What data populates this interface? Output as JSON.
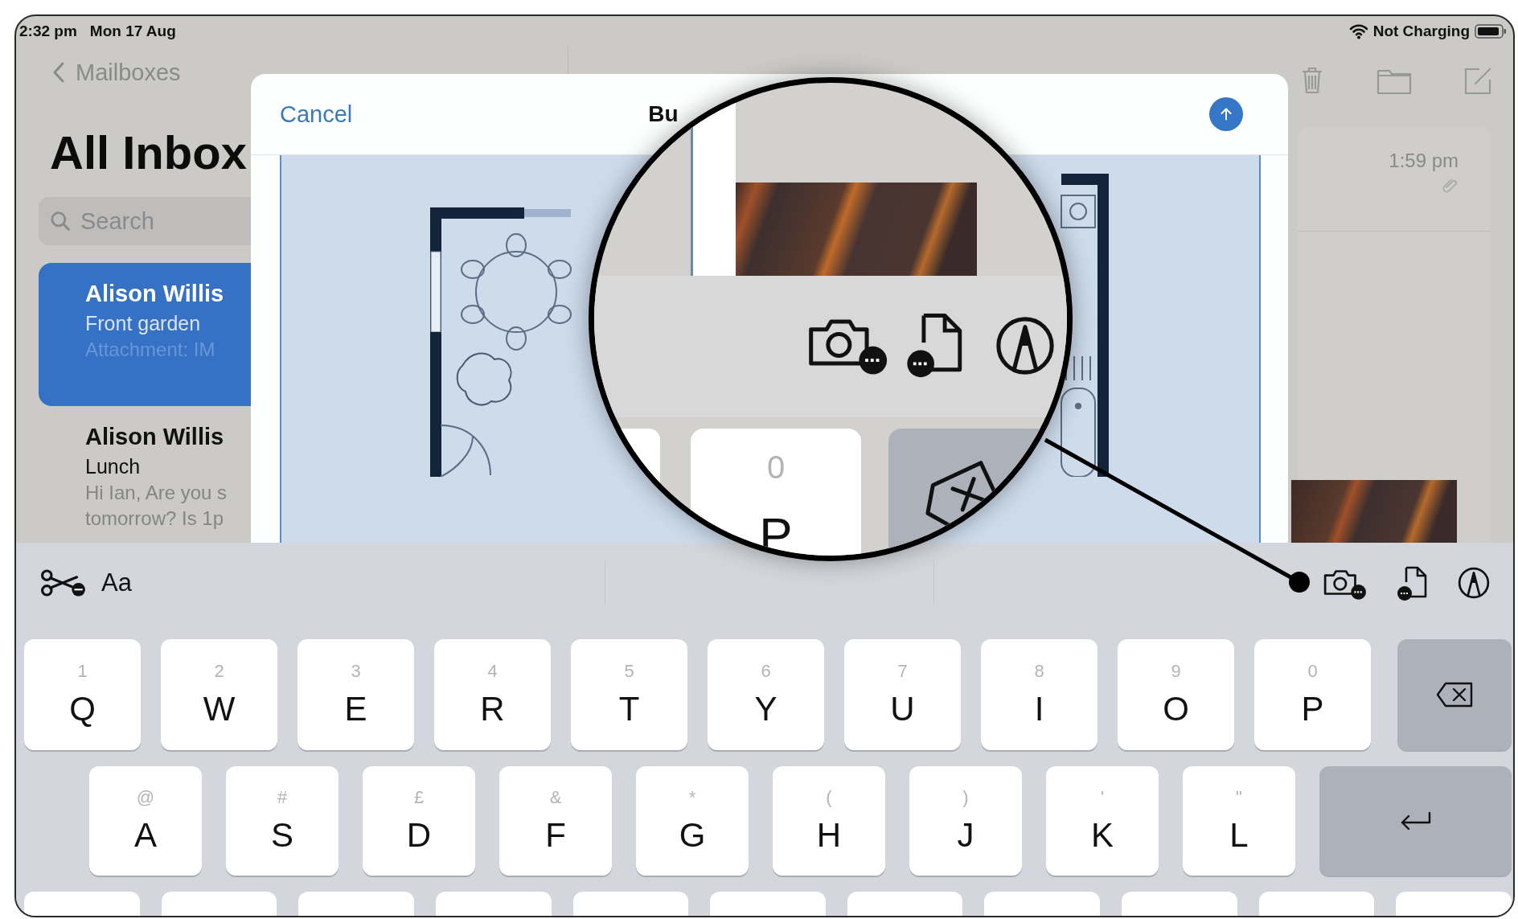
{
  "status_bar": {
    "time": "2:32 pm",
    "date": "Mon 17 Aug",
    "battery_label": "Not Charging"
  },
  "sidebar": {
    "back_label": "Mailboxes",
    "title": "All Inbox",
    "search": {
      "placeholder": "Search"
    },
    "messages": [
      {
        "sender": "Alison Willis",
        "subject": "Front garden",
        "preview": [
          "Attachment: IM"
        ],
        "selected": true
      },
      {
        "sender": "Alison Willis",
        "subject": "Lunch",
        "preview": [
          "Hi Ian, Are you s",
          "tomorrow? Is 1p"
        ],
        "selected": false
      }
    ]
  },
  "message_header": {
    "time": "1:59 pm"
  },
  "compose_sheet": {
    "cancel_label": "Cancel",
    "title": "Bu"
  },
  "keyboard": {
    "format_label": "Aa",
    "rows": [
      [
        {
          "kind": "letter",
          "label": "Q",
          "hint": "1"
        },
        {
          "kind": "letter",
          "label": "W",
          "hint": "2"
        },
        {
          "kind": "letter",
          "label": "E",
          "hint": "3"
        },
        {
          "kind": "letter",
          "label": "R",
          "hint": "4"
        },
        {
          "kind": "letter",
          "label": "T",
          "hint": "5"
        },
        {
          "kind": "letter",
          "label": "Y",
          "hint": "6"
        },
        {
          "kind": "letter",
          "label": "U",
          "hint": "7"
        },
        {
          "kind": "letter",
          "label": "I",
          "hint": "8"
        },
        {
          "kind": "letter",
          "label": "O",
          "hint": "9"
        },
        {
          "kind": "letter",
          "label": "P",
          "hint": "0"
        },
        {
          "kind": "delete"
        }
      ],
      [
        {
          "kind": "letter",
          "label": "A",
          "hint": "@"
        },
        {
          "kind": "letter",
          "label": "S",
          "hint": "#"
        },
        {
          "kind": "letter",
          "label": "D",
          "hint": "£"
        },
        {
          "kind": "letter",
          "label": "F",
          "hint": "&"
        },
        {
          "kind": "letter",
          "label": "G",
          "hint": "*"
        },
        {
          "kind": "letter",
          "label": "H",
          "hint": "("
        },
        {
          "kind": "letter",
          "label": "J",
          "hint": ")"
        },
        {
          "kind": "letter",
          "label": "K",
          "hint": "'"
        },
        {
          "kind": "letter",
          "label": "L",
          "hint": "\""
        },
        {
          "kind": "return"
        }
      ],
      [
        {
          "kind": "stub"
        },
        {
          "kind": "stub"
        },
        {
          "kind": "stub"
        },
        {
          "kind": "stub"
        },
        {
          "kind": "stub"
        },
        {
          "kind": "stub"
        },
        {
          "kind": "stub"
        },
        {
          "kind": "stub"
        },
        {
          "kind": "stub"
        },
        {
          "kind": "stub"
        },
        {
          "kind": "stub"
        }
      ]
    ]
  },
  "magnifier": {
    "key_hint": "0",
    "key_label": "P"
  }
}
